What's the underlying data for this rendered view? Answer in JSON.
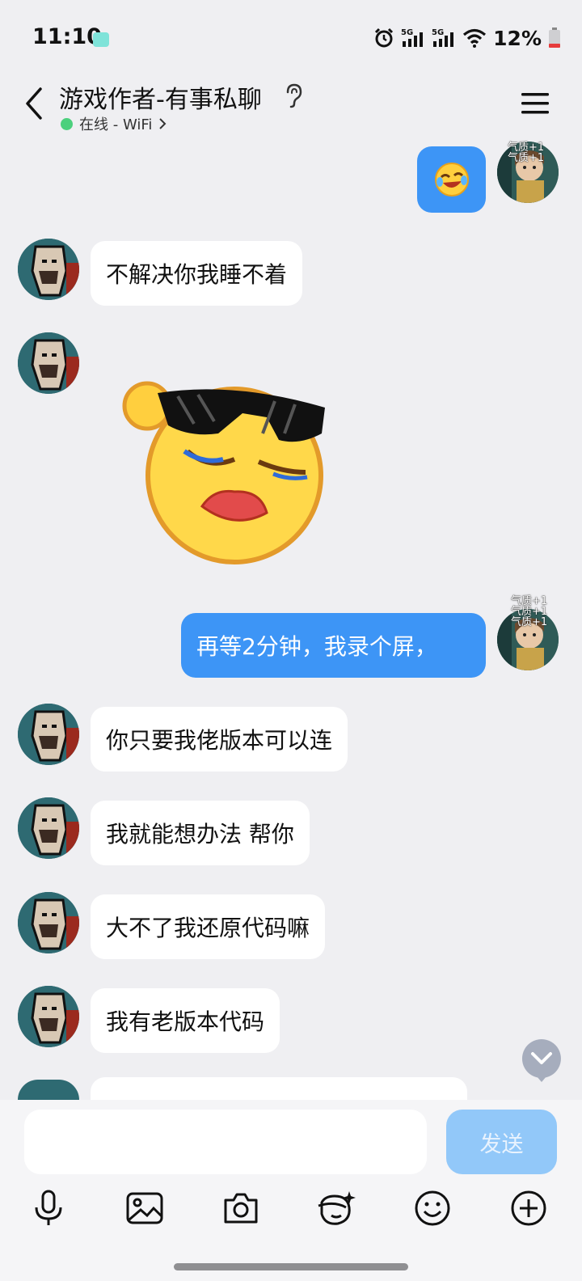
{
  "status_bar": {
    "time": "11:10",
    "network_1": "5G",
    "network_2": "5G",
    "battery": "12%",
    "icons": [
      "app-notification-icon",
      "alarm-icon",
      "signal-icon",
      "wifi-icon",
      "battery-icon"
    ]
  },
  "header": {
    "title": "游戏作者-有事私聊",
    "presence": "在线 - WiFi",
    "presence_color": "#4cd07d",
    "icons": [
      "back-icon",
      "ear-icon",
      "chevron-right-icon",
      "menu-icon"
    ]
  },
  "self_badge": {
    "line1": "气质+1",
    "line2": "气质+1",
    "line3": "气质+1"
  },
  "messages": [
    {
      "side": "out",
      "type": "emoji",
      "emoji": "laughing-tears-emoji"
    },
    {
      "side": "in",
      "type": "text",
      "text": "不解决你我睡不着"
    },
    {
      "side": "in",
      "type": "sticker",
      "sticker": "sunglasses-sleepy-sticker"
    },
    {
      "side": "out",
      "type": "text",
      "text": "再等2分钟，我录个屏，"
    },
    {
      "side": "in",
      "type": "text",
      "text": "你只要我佬版本可以连"
    },
    {
      "side": "in",
      "type": "text",
      "text": "我就能想办法 帮你"
    },
    {
      "side": "in",
      "type": "text",
      "text": "大不了我还原代码嘛"
    },
    {
      "side": "in",
      "type": "text",
      "text": "我有老版本代码"
    }
  ],
  "composer": {
    "input_value": "",
    "send_label": "发送",
    "tools": [
      "microphone-icon",
      "image-icon",
      "camera-icon",
      "sticker-face-icon",
      "emoji-icon",
      "plus-icon"
    ]
  },
  "colors": {
    "outgoing_bubble": "#3d95f6",
    "incoming_bubble": "#ffffff",
    "background": "#efeff2",
    "send_button_disabled": "#92c8f9"
  }
}
